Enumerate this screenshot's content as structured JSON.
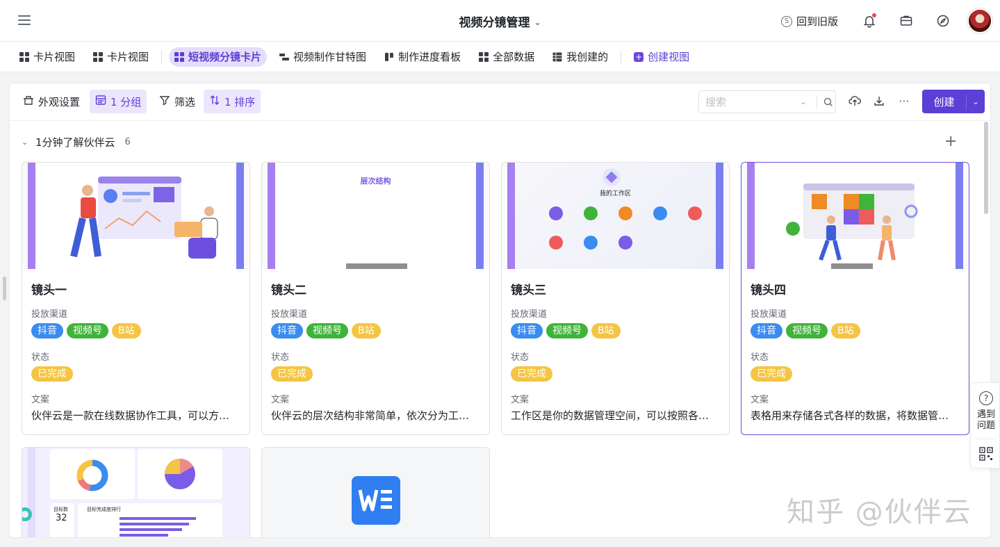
{
  "header": {
    "title": "视频分镜管理",
    "back_label": "回到旧版"
  },
  "views": [
    {
      "label": "卡片视图",
      "icon": "grid-icon",
      "active": false
    },
    {
      "label": "卡片视图",
      "icon": "grid-icon",
      "active": false
    },
    {
      "label": "短视频分镜卡片",
      "icon": "grid-icon",
      "active": true
    },
    {
      "label": "视频制作甘特图",
      "icon": "gantt-icon",
      "active": false
    },
    {
      "label": "制作进度看板",
      "icon": "kanban-icon",
      "active": false
    },
    {
      "label": "全部数据",
      "icon": "grid-icon",
      "active": false
    },
    {
      "label": "我创建的",
      "icon": "table-icon",
      "active": false
    }
  ],
  "create_view_label": "创建视图",
  "toolbar": {
    "appearance": "外观设置",
    "group": "1 分组",
    "filter": "筛选",
    "sort": "1 排序",
    "search_placeholder": "搜索",
    "create": "创建"
  },
  "group": {
    "name": "1分钟了解伙伴云",
    "count": "6"
  },
  "field_labels": {
    "channel": "投放渠道",
    "status": "状态",
    "copy": "文案"
  },
  "cards": [
    {
      "name": "镜头一",
      "channels": [
        "抖音",
        "视频号",
        "B站"
      ],
      "status": "已完成",
      "copy": "伙伴云是一款在线数据协作工具，可以方便地管理各种数据",
      "cover_title": ""
    },
    {
      "name": "镜头二",
      "channels": [
        "抖音",
        "视频号",
        "B站"
      ],
      "status": "已完成",
      "copy": "伙伴云的层次结构非常简单，依次分为工作区、表格",
      "cover_title": "层次结构"
    },
    {
      "name": "镜头三",
      "channels": [
        "抖音",
        "视频号",
        "B站"
      ],
      "status": "已完成",
      "copy": "工作区是你的数据管理空间，可以按照各类业务创建",
      "cover_title": "我的工作区"
    },
    {
      "name": "镜头四",
      "channels": [
        "抖音",
        "视频号",
        "B站"
      ],
      "status": "已完成",
      "copy": "表格用来存储各式各样的数据，将数据管理起来",
      "cover_title": ""
    }
  ],
  "dashboard_card": {
    "metric_label": "目标数",
    "metric_value": "32",
    "list_title": "目标完成度排行"
  },
  "help": {
    "label": "遇到问题"
  },
  "watermark": "知乎 @伙伴云",
  "colors": {
    "accent": "#5b3fd6",
    "tag_blue": "#3a8cf0",
    "tag_green": "#3fb33a",
    "tag_yellow": "#f5c443"
  }
}
